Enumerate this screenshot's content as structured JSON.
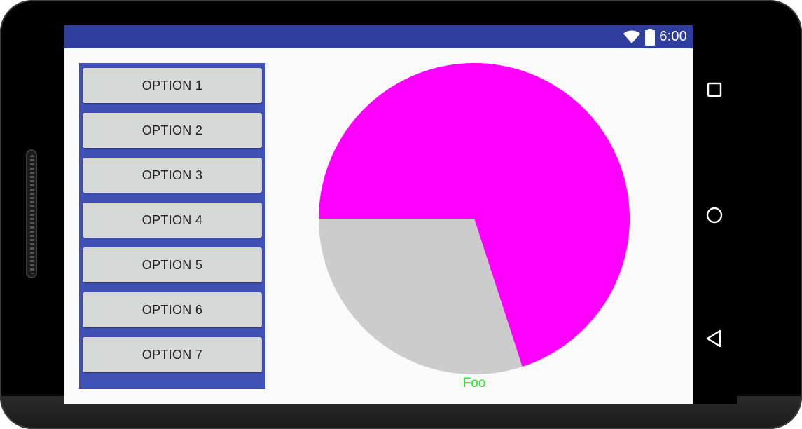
{
  "status_bar": {
    "time": "6:00",
    "color": "#303f9f",
    "icons": [
      "wifi-icon",
      "battery-icon"
    ]
  },
  "options_panel": {
    "color": "#3f51b5",
    "buttons": [
      {
        "label": "OPTION 1"
      },
      {
        "label": "OPTION 2"
      },
      {
        "label": "OPTION 3"
      },
      {
        "label": "OPTION 4"
      },
      {
        "label": "OPTION 5"
      },
      {
        "label": "OPTION 6"
      },
      {
        "label": "OPTION 7"
      }
    ]
  },
  "chart_data": {
    "type": "pie",
    "slices": [
      {
        "value": 70,
        "color": "#ff00ff"
      },
      {
        "value": 30,
        "color": "#cccccc"
      }
    ],
    "label": "Foo",
    "label_color": "#22ee22"
  },
  "nav_bar": {
    "icons": [
      "recents-square-icon",
      "home-circle-icon",
      "back-triangle-icon"
    ]
  }
}
